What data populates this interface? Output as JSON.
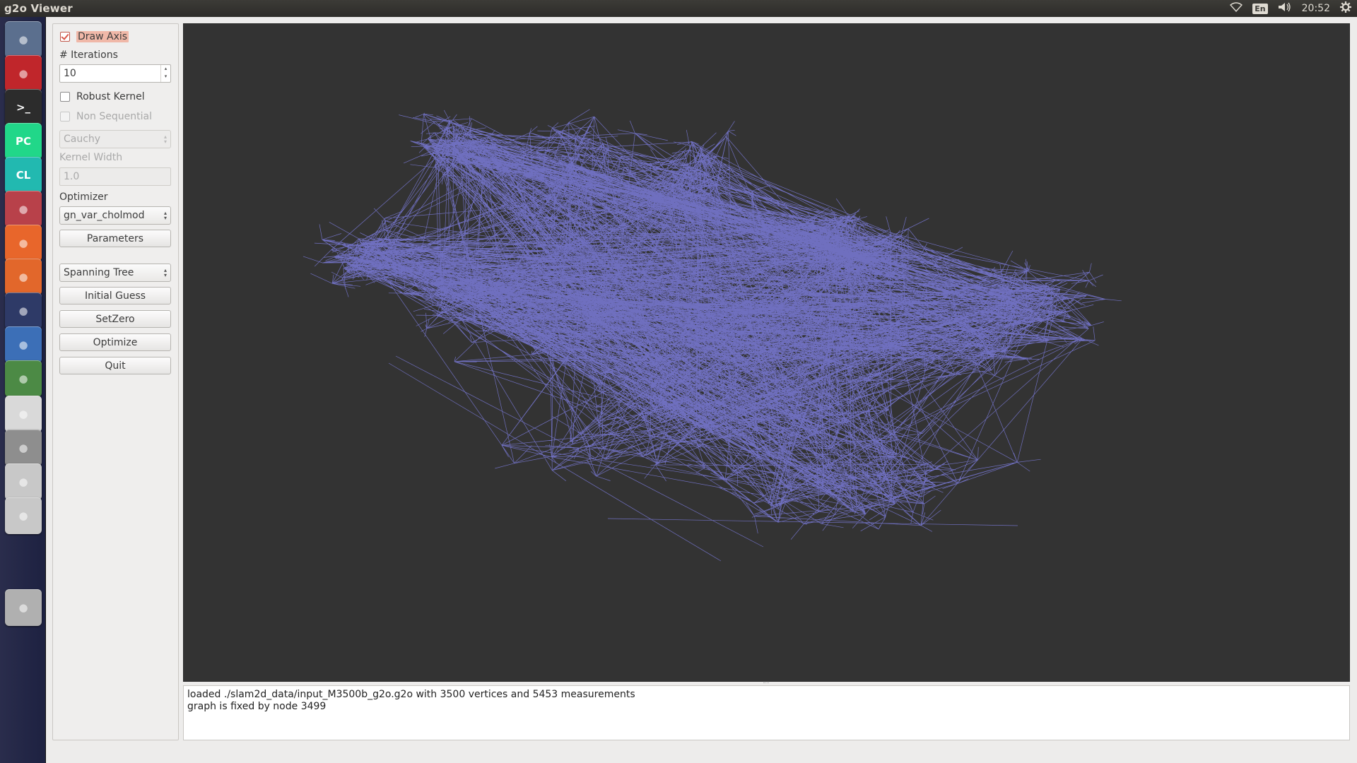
{
  "top_panel": {
    "title": "g2o Viewer",
    "language": "En",
    "clock": "20:52"
  },
  "launcher": {
    "items": [
      {
        "name": "dash-button",
        "icon": "ubuntu-logo-icon",
        "color": "#5b6f8e"
      },
      {
        "name": "launcher-recorder",
        "icon": "screen-recorder-icon",
        "color": "#c0262b"
      },
      {
        "name": "launcher-terminal",
        "icon": "terminal-icon",
        "color": "#2c2c2c",
        "label": ">_"
      },
      {
        "name": "launcher-pycharm",
        "icon": "pycharm-icon",
        "color": "#21d789",
        "label": "PC"
      },
      {
        "name": "launcher-clion",
        "icon": "clion-icon",
        "color": "#22b9b0",
        "label": "CL"
      },
      {
        "name": "launcher-files",
        "icon": "file-manager-icon",
        "color": "#b8414a"
      },
      {
        "name": "launcher-firefox",
        "icon": "firefox-icon",
        "color": "#e8662b"
      },
      {
        "name": "launcher-software-center",
        "icon": "software-center-icon",
        "color": "#e2672b"
      },
      {
        "name": "launcher-vlc",
        "icon": "vlc-icon",
        "color": "#2e3a67"
      },
      {
        "name": "launcher-ubuntu-one",
        "icon": "ubuntu-circle-icon",
        "color": "#3c6fb7"
      },
      {
        "name": "launcher-software-updater",
        "icon": "software-updater-icon",
        "color": "#4c8a45"
      },
      {
        "name": "launcher-text-editor",
        "icon": "text-editor-icon",
        "color": "#d9d9d9"
      },
      {
        "name": "launcher-help",
        "icon": "help-icon",
        "color": "#8e8e8e"
      },
      {
        "name": "launcher-drive-1",
        "icon": "drive-icon",
        "color": "#c8c8c8"
      },
      {
        "name": "launcher-drive-2",
        "icon": "drive-icon",
        "color": "#c8c8c8"
      },
      {
        "name": "launcher-trash",
        "icon": "trash-icon",
        "color": "#b0b0b0"
      }
    ]
  },
  "controls": {
    "draw_axis": {
      "label": "Draw Axis",
      "checked": true
    },
    "iterations_label": "# Iterations",
    "iterations_value": "10",
    "robust_kernel": {
      "label": "Robust Kernel",
      "checked": false
    },
    "non_sequential": {
      "label": "Non Sequential",
      "checked": false,
      "disabled": true
    },
    "kernel_type": "Cauchy",
    "kernel_width_label": "Kernel Width",
    "kernel_width_value": "1.0",
    "optimizer_label": "Optimizer",
    "optimizer_value": "gn_var_cholmod",
    "parameters_button": "Parameters",
    "initial_guess_method": "Spanning Tree",
    "initial_guess_button": "Initial Guess",
    "setzero_button": "SetZero",
    "optimize_button": "Optimize",
    "quit_button": "Quit"
  },
  "viewer": {
    "background_color": "#333333",
    "edge_color": "#7a7ad8"
  },
  "log": {
    "lines": [
      "loaded ./slam2d_data/input_M3500b_g2o.g2o with 3500 vertices and 5453 measurements",
      "graph is fixed by node 3499"
    ]
  }
}
